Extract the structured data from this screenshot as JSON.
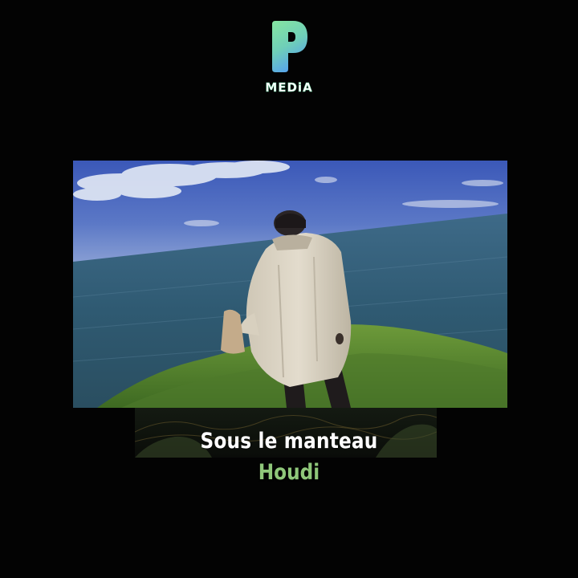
{
  "brand": {
    "logo_icon": "p-letter-logo-icon",
    "wordmark": "MEDiA",
    "colors": {
      "gradient_top": "#7fe3a0",
      "gradient_bottom": "#5aa7e8"
    }
  },
  "video": {
    "scene": "person-in-coat-on-cliff-image"
  },
  "caption": {
    "title": "Sous le manteau",
    "artist": "Houdi",
    "colors": {
      "title": "#ffffff",
      "artist": "#8fc77a"
    }
  }
}
